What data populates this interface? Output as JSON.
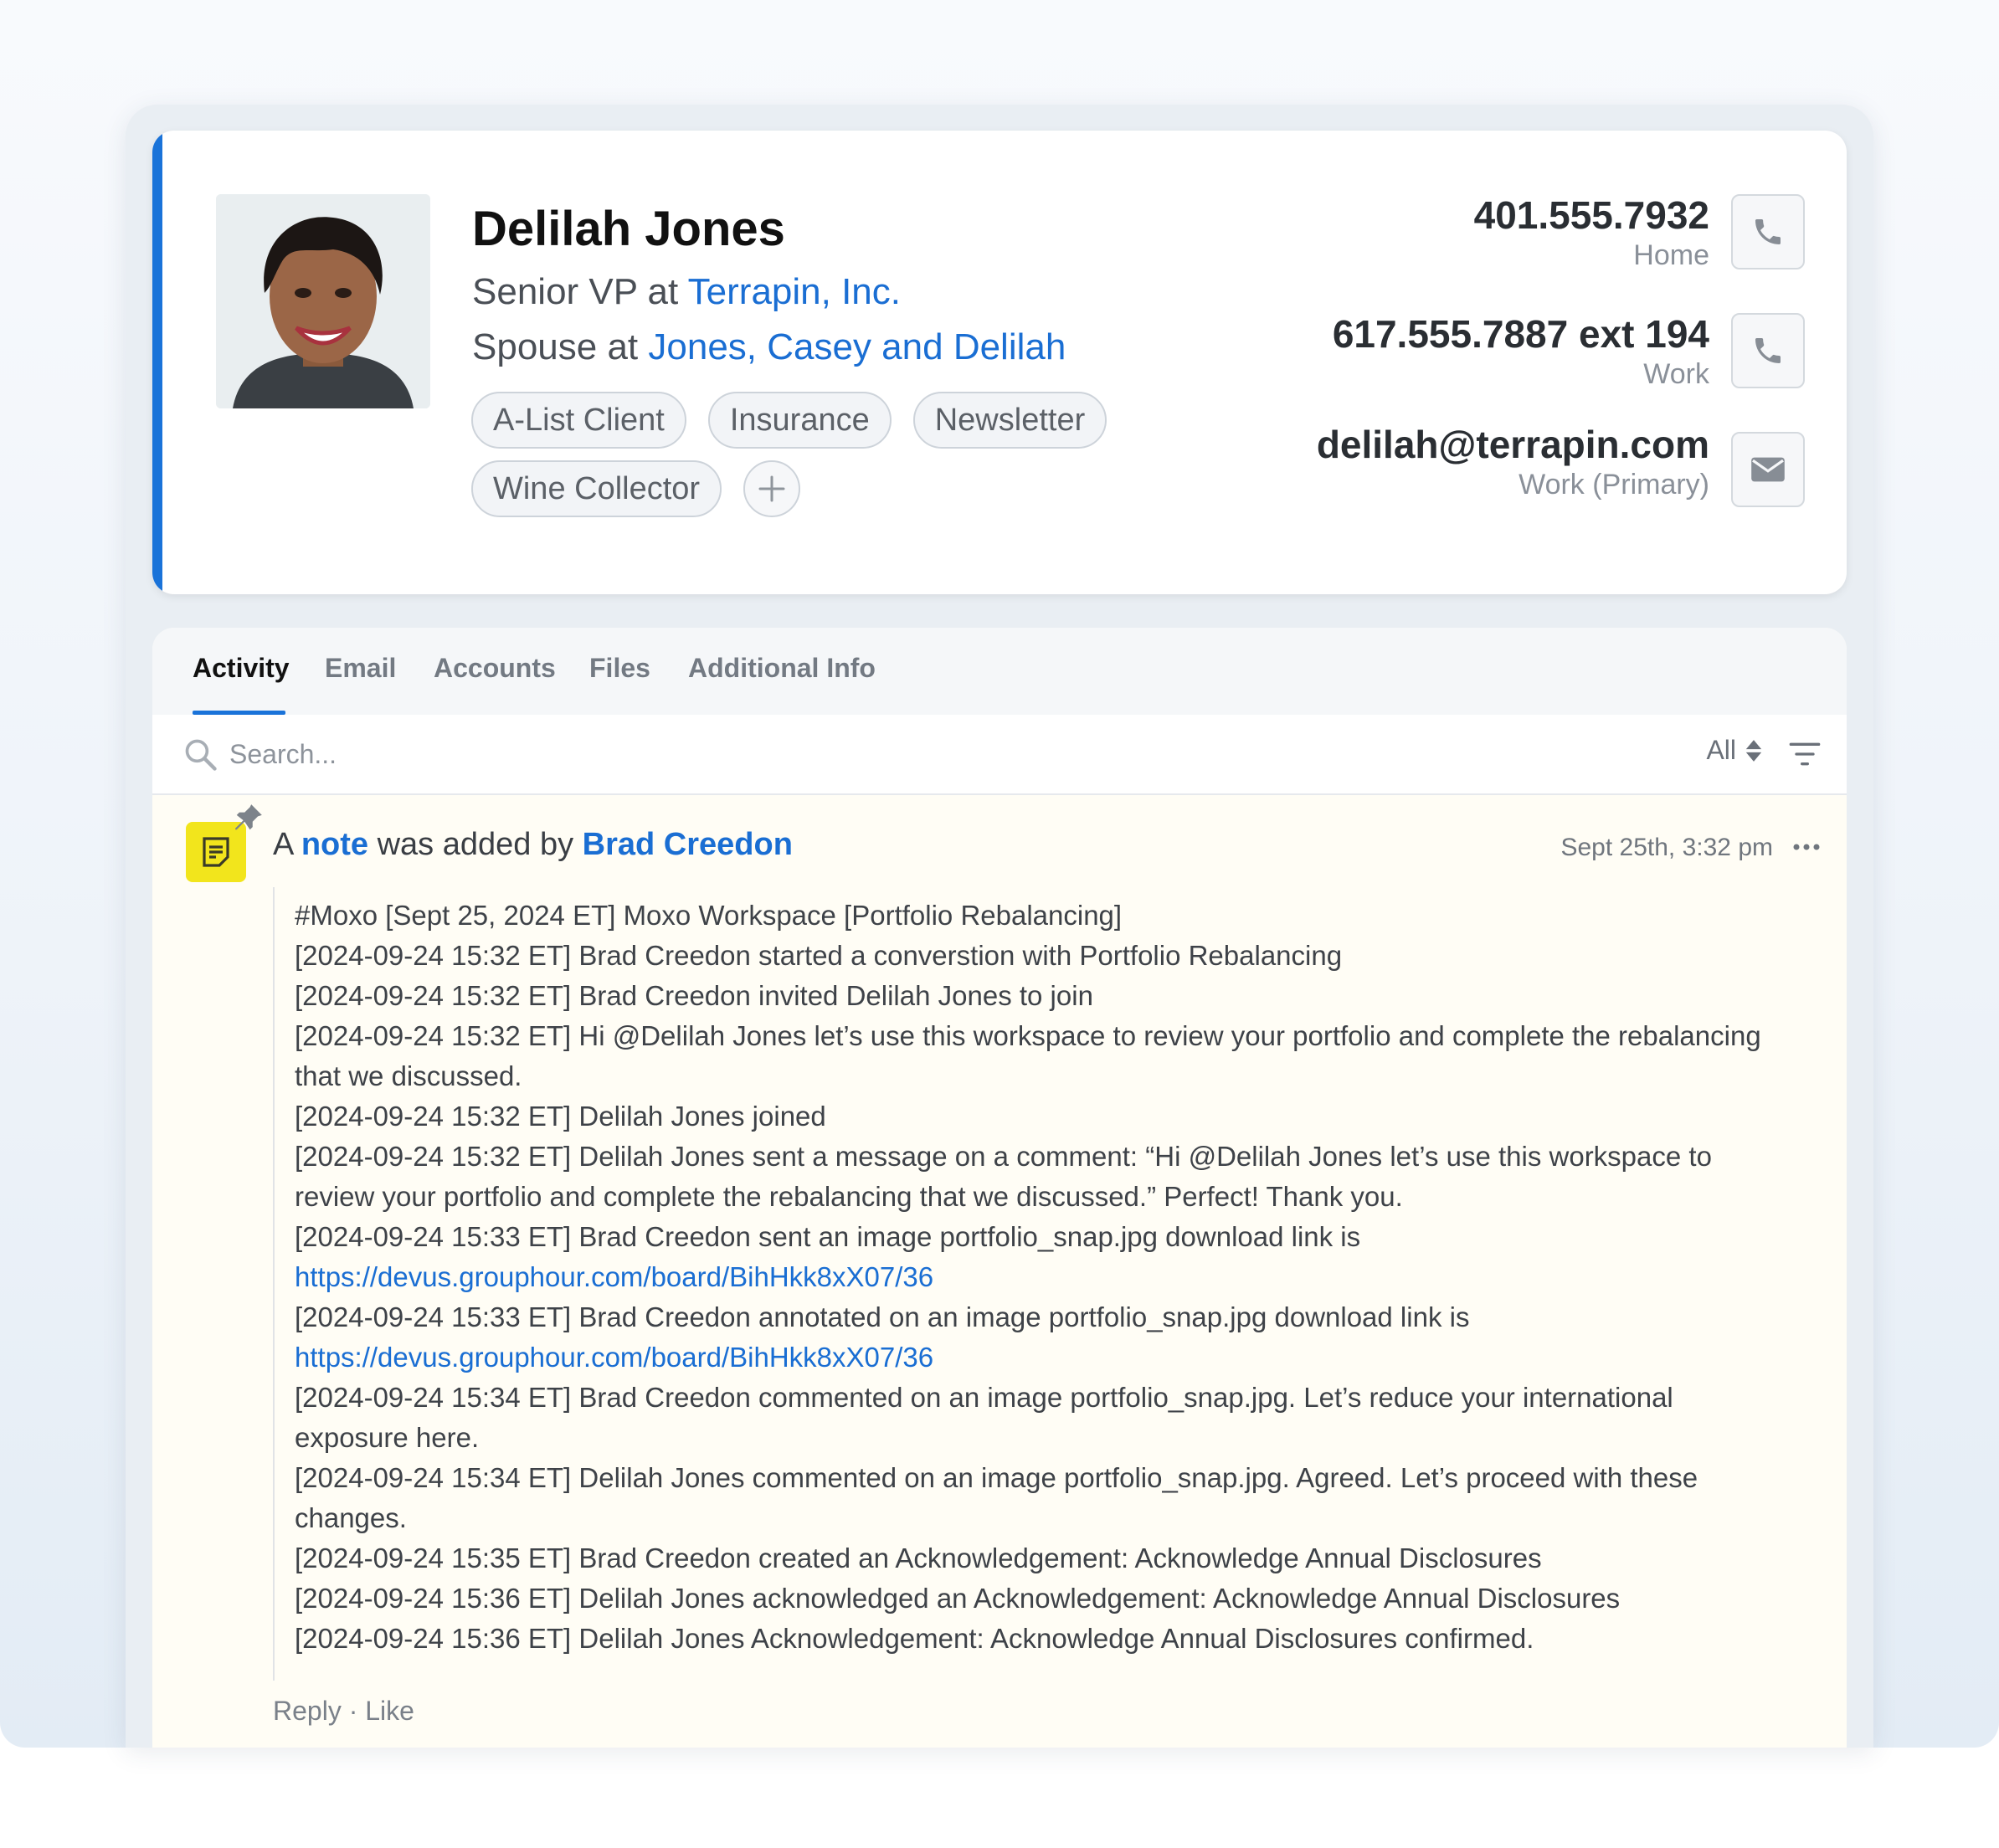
{
  "contact": {
    "name": "Delilah Jones",
    "roles": [
      {
        "prefix": "Senior VP at ",
        "link": "Terrapin, Inc."
      },
      {
        "prefix": "Spouse at ",
        "link": "Jones, Casey and Delilah"
      }
    ],
    "tags": [
      "A-List Client",
      "Insurance",
      "Newsletter",
      "Wine Collector"
    ],
    "phones": [
      {
        "value": "401.555.7932",
        "label": "Home"
      },
      {
        "value": "617.555.7887 ext 194",
        "label": "Work"
      }
    ],
    "email": {
      "value": "delilah@terrapin.com",
      "label": "Work (Primary)"
    }
  },
  "tabs": [
    "Activity",
    "Email",
    "Accounts",
    "Files",
    "Additional Info"
  ],
  "search": {
    "placeholder": "Search...",
    "filter_value": "All"
  },
  "note": {
    "prefix": "A ",
    "type_link": "note",
    "middle": " was added by ",
    "author": "Brad Creedon",
    "timestamp": "Sept 25th, 3:32 pm",
    "lines": [
      {
        "text": "#Moxo [Sept 25, 2024 ET] Moxo Workspace [Portfolio Rebalancing]"
      },
      {
        "text": "[2024-09-24 15:32 ET] Brad Creedon started a converstion with Portfolio Rebalancing"
      },
      {
        "text": "[2024-09-24 15:32 ET] Brad Creedon invited Delilah Jones to join"
      },
      {
        "text": "[2024-09-24 15:32 ET] Hi @Delilah Jones let’s use this workspace to review your portfolio and complete the rebalancing that we discussed."
      },
      {
        "text": "[2024-09-24 15:32 ET] Delilah Jones joined"
      },
      {
        "text": "[2024-09-24 15:32 ET] Delilah Jones sent a message on a comment: “Hi @Delilah Jones let’s use this workspace to review your portfolio and complete the rebalancing that we discussed.” Perfect! Thank you."
      },
      {
        "text": "[2024-09-24 15:33 ET] Brad Creedon sent an image portfolio_snap.jpg download link is ",
        "link": "https://devus.grouphour.com/board/BihHkk8xX07/36"
      },
      {
        "text": "[2024-09-24 15:33 ET] Brad Creedon annotated on an image portfolio_snap.jpg download link is ",
        "link": "https://devus.grouphour.com/board/BihHkk8xX07/36"
      },
      {
        "text": "[2024-09-24 15:34 ET] Brad Creedon commented on an image portfolio_snap.jpg. Let’s reduce your international exposure here."
      },
      {
        "text": "[2024-09-24 15:34 ET] Delilah Jones commented on an image portfolio_snap.jpg. Agreed. Let’s proceed with these changes."
      },
      {
        "text": "[2024-09-24 15:35 ET] Brad Creedon created an Acknowledgement: Acknowledge Annual Disclosures"
      },
      {
        "text": "[2024-09-24 15:36 ET] Delilah Jones acknowledged an Acknowledgement: Acknowledge Annual Disclosures"
      },
      {
        "text": "[2024-09-24 15:36 ET] Delilah Jones Acknowledgement: Acknowledge Annual Disclosures confirmed."
      }
    ],
    "actions": {
      "reply": "Reply",
      "separator": " · ",
      "like": "Like"
    }
  },
  "colors": {
    "accent": "#1a73d9",
    "link": "#1a6ed3",
    "note_icon": "#f2e51c"
  },
  "icons": [
    "phone-icon",
    "mail-icon",
    "plus-icon",
    "search-icon",
    "sort-arrows-icon",
    "filter-icon",
    "note-icon",
    "pin-icon",
    "more-icon"
  ]
}
